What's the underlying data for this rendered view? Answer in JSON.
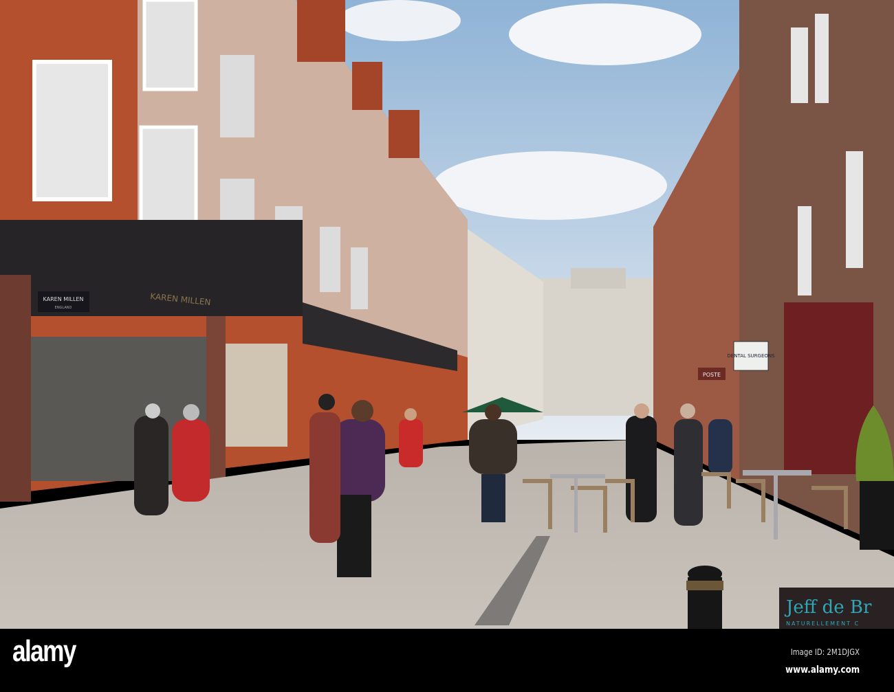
{
  "photo": {
    "signs": {
      "karen_millen_panel": "KAREN MILLEN",
      "karen_millen_sub": "ENGLAND",
      "karen_millen_facade": "KAREN MILLEN",
      "dental": "DENTAL SURGEONS",
      "poste": "POSTE",
      "jeff_title": "Jeff de Br",
      "jeff_sub": "NATURELLEMENT C"
    },
    "colors": {
      "sky": "#a9c6e0",
      "brick": "#b5502f",
      "pavement": "#bdb6ad"
    }
  },
  "watermark": {
    "logo": "alamy",
    "image_id": "Image ID: 2M1DJGX",
    "url": "www.alamy.com"
  }
}
